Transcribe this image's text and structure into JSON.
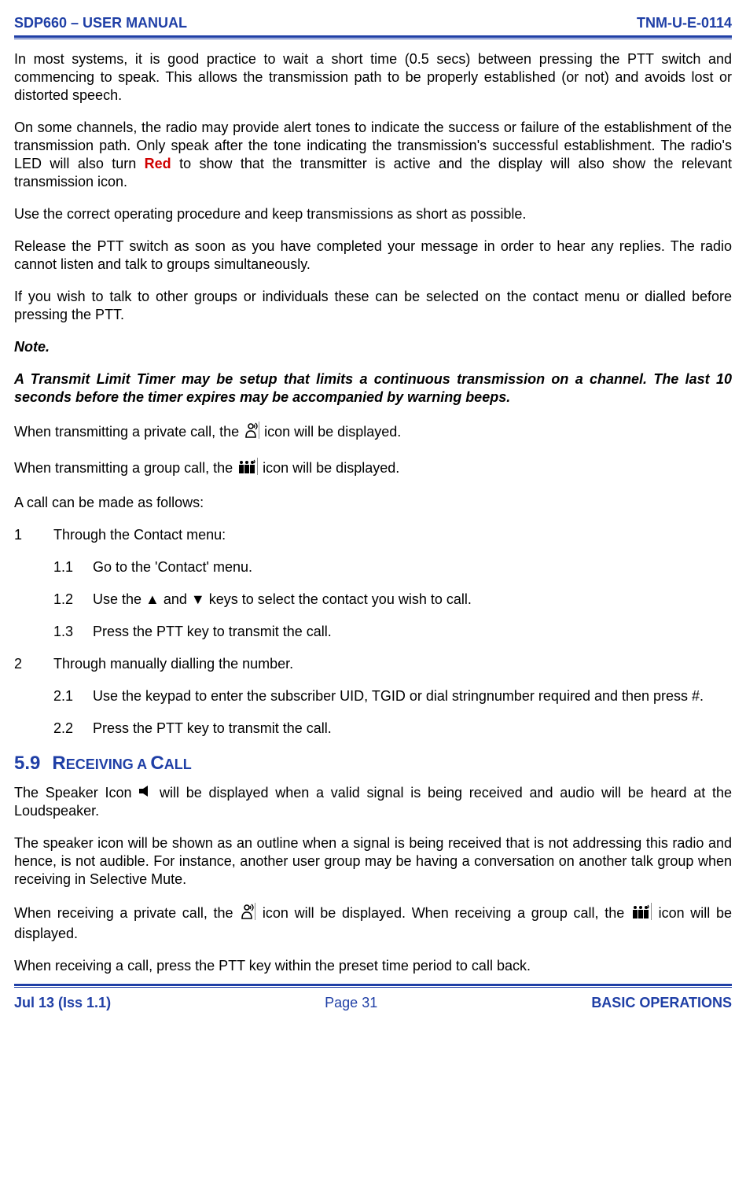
{
  "header": {
    "left": "SDP660 – USER MANUAL",
    "right": "TNM-U-E-0114"
  },
  "p1": "In most systems, it is good practice to wait a short time (0.5 secs) between pressing the PTT switch and commencing to speak.  This allows the transmission path to be properly established (or not) and avoids lost or distorted speech.",
  "p2a": "On some channels, the radio may provide alert tones to indicate the success or failure of the establishment of the transmission path.  Only speak after the tone indicating the transmission's successful establishment.  The radio's LED will also turn ",
  "p2red": "Red",
  "p2b": " to show that the transmitter is active and the display will also show the relevant transmission icon.",
  "p3": "Use the correct operating procedure and keep transmissions as short as possible.",
  "p4": "Release the PTT switch as soon as you have completed your message in order to hear any replies.  The radio cannot listen and talk to groups simultaneously.",
  "p5": "If you wish to talk to other groups or individuals these can be selected on the contact menu or dialled before pressing the PTT.",
  "noteLead": "Note.",
  "noteBody": "A Transmit Limit Timer may be setup that limits a continuous transmission on a channel.  The last 10 seconds before the timer expires may be accompanied by warning beeps.",
  "p6a": "When transmitting a private call, the ",
  "p6b": " icon will be displayed.",
  "p7a": "When transmitting a group call, the ",
  "p7b": " icon will be displayed.",
  "p8": "A call can be made as follows:",
  "list": {
    "n1": "1",
    "t1": "Through the Contact menu:",
    "n11": "1.1",
    "t11": "Go to the 'Contact' menu.",
    "n12": "1.2",
    "t12": "Use the ▲ and ▼ keys to select the contact you wish to call.",
    "n13": "1.3",
    "t13": "Press the PTT key to transmit the call.",
    "n2": "2",
    "t2": "Through manually dialling the number.",
    "n21": "2.1",
    "t21": "Use the keypad to enter the subscriber UID, TGID or  dial stringnumber required and then press #.",
    "n22": "2.2",
    "t22": "Press the PTT key to transmit the call."
  },
  "h59": {
    "no": "5.9",
    "init1": "R",
    "rest1": "ECEIVING A ",
    "init2": "C",
    "rest2": "ALL"
  },
  "ra": "The Speaker Icon ",
  "rb": " will be displayed when a valid signal is being received and audio will be heard at the Loudspeaker.",
  "r2": "The speaker icon will be shown as an outline when a signal is being received that is not addressing this radio and hence, is not audible.  For instance, another user group may be having a conversation on another talk group when receiving in Selective Mute.",
  "r3a": "When receiving a private call, the ",
  "r3b": " icon will be displayed.  When receiving a group call, the ",
  "r3c": " icon will be displayed.",
  "r4": "When receiving a call, press the PTT key within the preset time period to call back.",
  "footer": {
    "left": "Jul 13 (Iss 1.1)",
    "center": "Page 31",
    "right": "BASIC OPERATIONS"
  }
}
